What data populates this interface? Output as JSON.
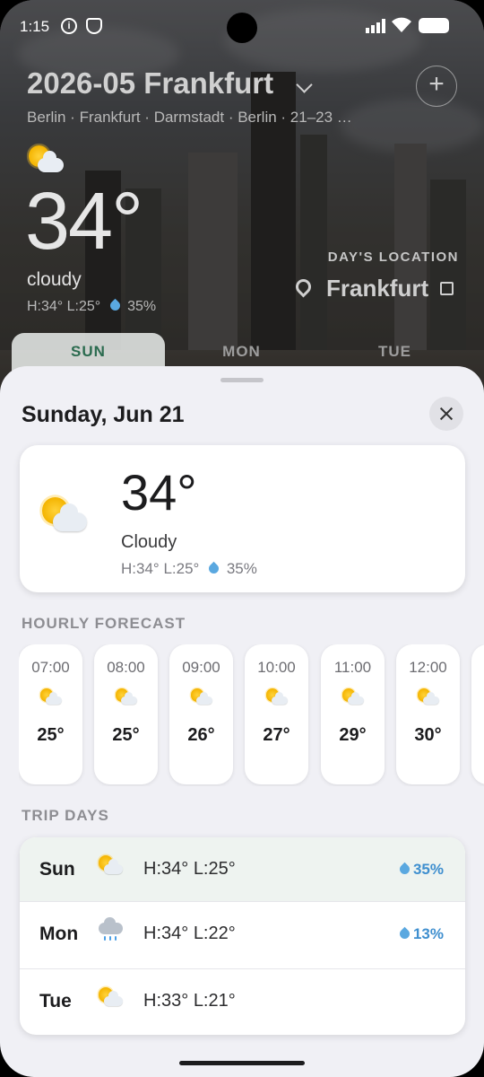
{
  "status": {
    "time": "1:15"
  },
  "header": {
    "trip_title": "2026-05 Frankfurt",
    "trip_cities": "Berlin · Frankfurt · Darmstadt · Berlin · 21–23 …",
    "temp": "34°",
    "condition": "cloudy",
    "hi": "H:34°",
    "lo": "L:25°",
    "rain": "35%",
    "day_location_label": "DAY'S LOCATION",
    "day_location_city": "Frankfurt"
  },
  "tabs": [
    {
      "label": "SUN",
      "active": true
    },
    {
      "label": "MON",
      "active": false
    },
    {
      "label": "TUE",
      "active": false
    }
  ],
  "sheet": {
    "title": "Sunday, Jun 21",
    "card": {
      "temp": "34°",
      "condition": "Cloudy",
      "hi": "H:34°",
      "lo": "L:25°",
      "rain": "35%"
    },
    "hourly_label": "HOURLY FORECAST",
    "hourly": [
      {
        "time": "07:00",
        "icon": "sun-behind-cloud-icon",
        "temp": "25°"
      },
      {
        "time": "08:00",
        "icon": "sun-behind-cloud-icon",
        "temp": "25°"
      },
      {
        "time": "09:00",
        "icon": "sun-behind-cloud-icon",
        "temp": "26°"
      },
      {
        "time": "10:00",
        "icon": "sun-behind-cloud-icon",
        "temp": "27°"
      },
      {
        "time": "11:00",
        "icon": "sun-behind-cloud-icon",
        "temp": "29°"
      },
      {
        "time": "12:00",
        "icon": "sun-behind-cloud-icon",
        "temp": "30°"
      }
    ],
    "trip_days_label": "TRIP DAYS",
    "trip_days": [
      {
        "day": "Sun",
        "icon": "sun-behind-cloud-icon",
        "hi": "H:34°",
        "lo": "L:25°",
        "rain": "35%",
        "selected": true
      },
      {
        "day": "Mon",
        "icon": "rain-cloud-icon",
        "hi": "H:34°",
        "lo": "L:22°",
        "rain": "13%",
        "selected": false
      },
      {
        "day": "Tue",
        "icon": "sun-behind-cloud-icon",
        "hi": "H:33°",
        "lo": "L:21°",
        "rain": "",
        "selected": false
      }
    ]
  },
  "colors": {
    "accent": "#2b6b4f",
    "rain": "#3f8fcf",
    "sheet_bg": "#f0f0f5"
  }
}
